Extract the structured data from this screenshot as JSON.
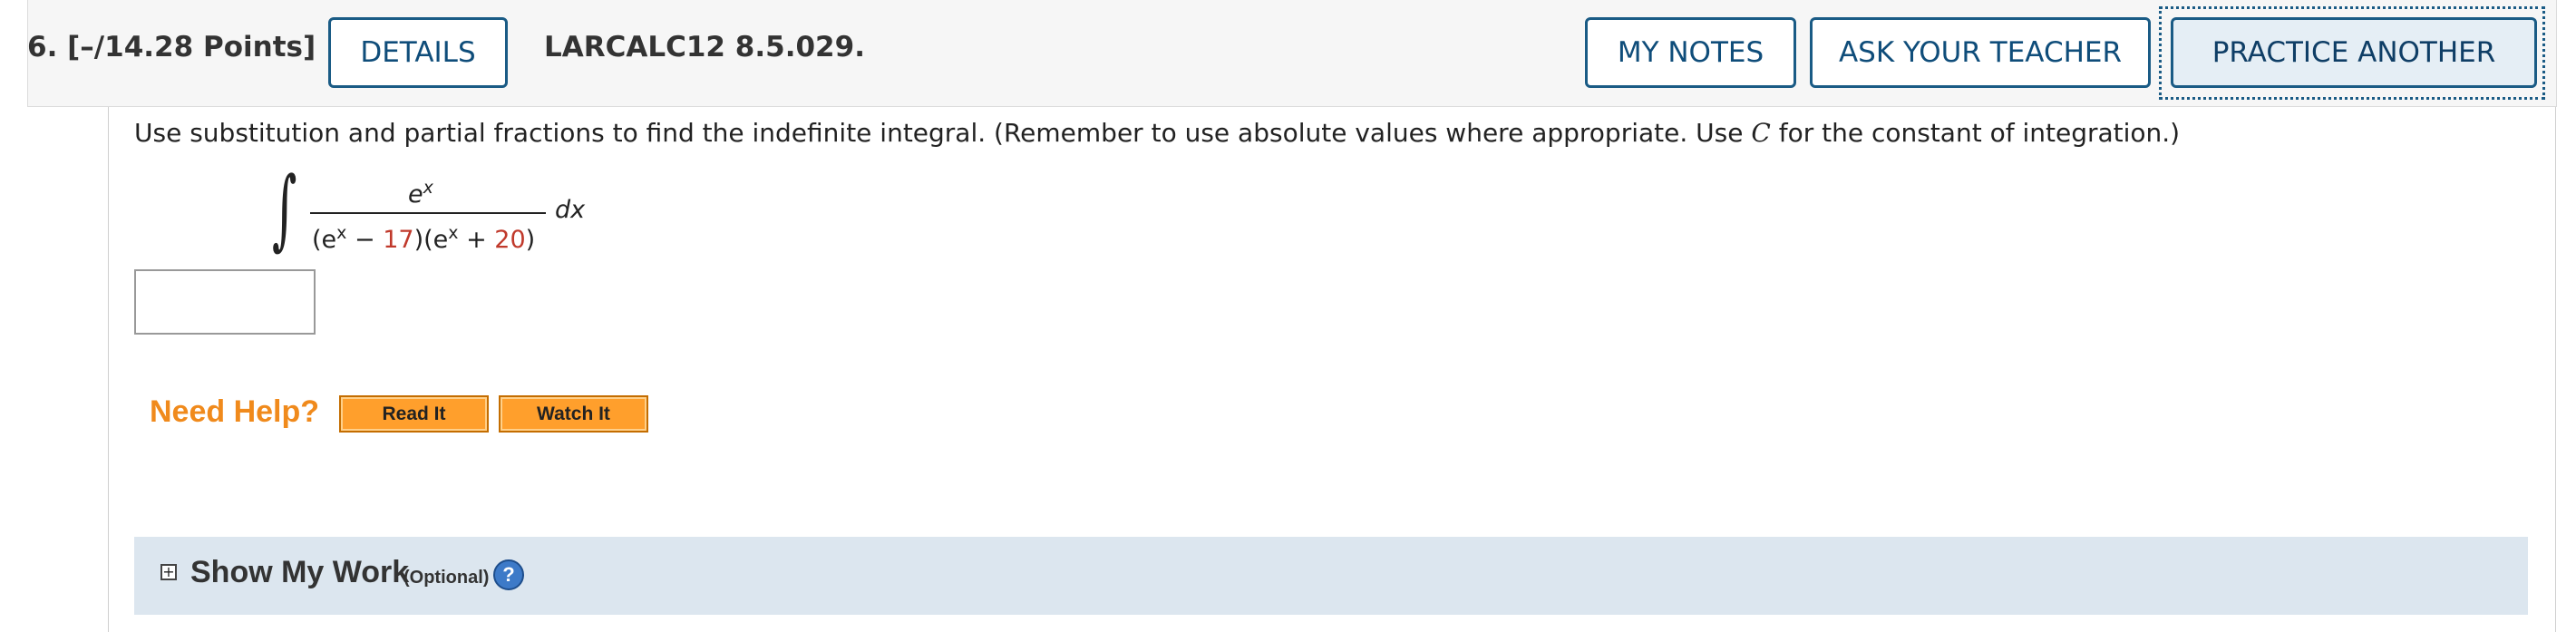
{
  "question": {
    "number_label": "6.  [–/14.28 Points]",
    "details_label": "DETAILS",
    "code": "LARCALC12 8.5.029.",
    "my_notes_label": "MY NOTES",
    "ask_teacher_label": "ASK YOUR TEACHER",
    "practice_another_label": "PRACTICE ANOTHER"
  },
  "problem": {
    "instruction_part1": "Use substitution and partial fractions to find the indefinite integral. (Remember to use absolute values where appropriate. Use ",
    "instruction_var": "C",
    "instruction_part2": " for the constant of integration.)",
    "integral_sign": "∫",
    "numerator_base": "e",
    "numerator_exp": "x",
    "den_open": "(e",
    "den_exp1": "x",
    "den_minus": " − ",
    "den_const1": "17",
    "den_mid": ")(e",
    "den_exp2": "x",
    "den_plus": " + ",
    "den_const2": "20",
    "den_close": ")",
    "differential": "dx",
    "answer_value": ""
  },
  "help": {
    "need_help_label": "Need Help?",
    "read_it_label": "Read It",
    "watch_it_label": "Watch It"
  },
  "show_work": {
    "toggle_symbol": "+",
    "title": "Show My Work",
    "optional_label": "(Optional)",
    "help_symbol": "?"
  },
  "colors": {
    "accent_blue": "#1a5b85",
    "highlight_red": "#c0392b",
    "need_help_orange": "#f08a1c",
    "help_button_orange": "#ff9f2c",
    "show_work_bg": "#dce6ef"
  }
}
